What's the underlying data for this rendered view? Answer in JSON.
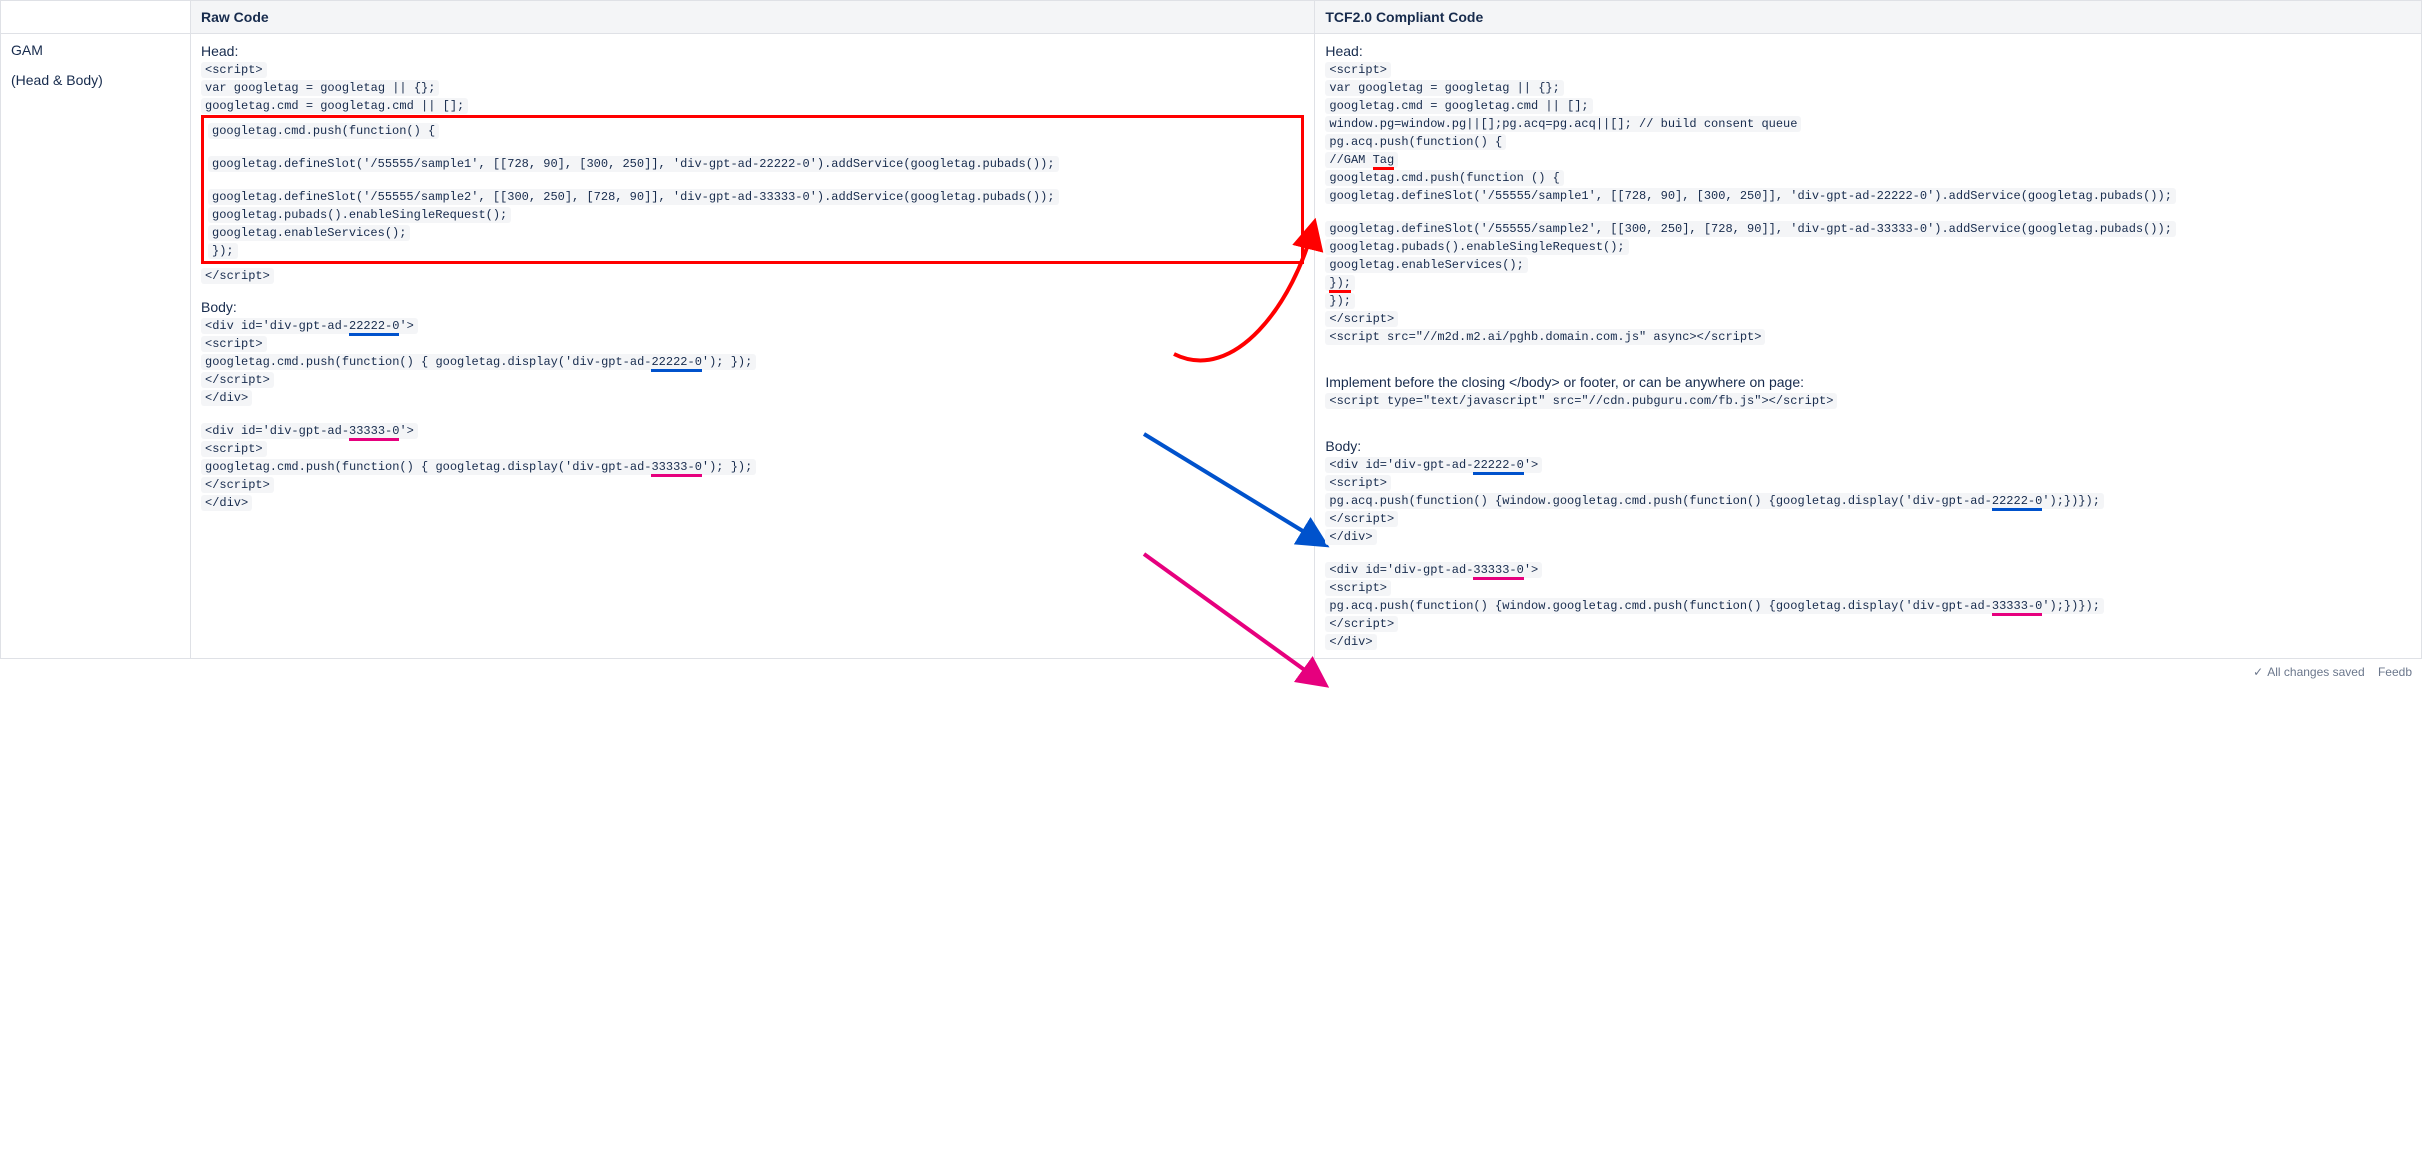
{
  "headers": {
    "col1": "",
    "col2": "Raw Code",
    "col3": "TCF2.0 Compliant Code"
  },
  "row": {
    "label_line1": "GAM",
    "label_line2": "(Head & Body)"
  },
  "raw": {
    "head_label": "Head:",
    "l1": "<script>",
    "l2": "var googletag = googletag || {};",
    "l3": "googletag.cmd = googletag.cmd || [];",
    "box_l1": "googletag.cmd.push(function() {",
    "box_l2": "googletag.defineSlot('/55555/sample1', [[728, 90], [300, 250]], 'div-gpt-ad-22222-0').addService(googletag.pubads());",
    "box_l3": "googletag.defineSlot('/55555/sample2', [[300, 250], [728, 90]], 'div-gpt-ad-33333-0').addService(googletag.pubads());",
    "box_l4": "googletag.pubads().enableSingleRequest();",
    "box_l5": "googletag.enableServices();",
    "box_l6": "});",
    "l4": "</script>",
    "body_label": "Body:",
    "b1a": "<div id='div-gpt-ad-",
    "b1b": "22222-0",
    "b1c": "'>",
    "b2": "<script>",
    "b3a": "googletag.cmd.push(function() { googletag.display('div-gpt-ad-",
    "b3b": "22222-0",
    "b3c": "'); });",
    "b4": "</script>",
    "b5": "</div>",
    "c1a": "<div id='div-gpt-ad-",
    "c1b": "33333-0",
    "c1c": "'>",
    "c2": "<script>",
    "c3a": "googletag.cmd.push(function() { googletag.display('div-gpt-ad-",
    "c3b": "33333-0",
    "c3c": "'); });",
    "c4": "</script>",
    "c5": "</div>"
  },
  "tcf": {
    "head_label": "Head:",
    "l1": "<script>",
    "l2": "var googletag = googletag || {};",
    "l3": "googletag.cmd = googletag.cmd || [];",
    "l4": "window.pg=window.pg||[];pg.acq=pg.acq||[]; // build consent queue",
    "l5a": "pg.acq.push(function() {",
    "l6a": "//GAM ",
    "l6b": "Tag",
    "h1": "googletag.cmd.push(function () {",
    "h2": "googletag.defineSlot('/55555/sample1', [[728, 90], [300, 250]], 'div-gpt-ad-22222-0').addService(googletag.pubads());",
    "h3": "googletag.defineSlot('/55555/sample2', [[300, 250], [728, 90]], 'div-gpt-ad-33333-0').addService(googletag.pubads());",
    "h4": "googletag.pubads().enableSingleRequest();",
    "h5": "googletag.enableServices();",
    "h6a": "});",
    "l7": "});",
    "l8": "</script>",
    "l9": "<script src=\"//m2d.m2.ai/pghb.domain.com.js\" async></script>",
    "note": "Implement before the closing </body> or footer, or can be anywhere on page:",
    "l10": "<script type=\"text/javascript\" src=\"//cdn.pubguru.com/fb.js\"></script>",
    "body_label": "Body:",
    "b1a": "<div id='div-gpt-ad-",
    "b1b": "22222-0",
    "b1c": "'>",
    "b2": "<script>",
    "b3a": "pg.acq.push(function() {window.googletag.cmd.push(function() {googletag.display('div-gpt-ad-",
    "b3b": "22222-0",
    "b3c": "');})});",
    "b4": "</script>",
    "b5": "</div>",
    "c1a": "<div id='div-gpt-ad-",
    "c1b": "33333-0",
    "c1c": "'>",
    "c2": "<script>",
    "c3a": "pg.acq.push(function() {window.googletag.cmd.push(function() {googletag.display('div-gpt-ad-",
    "c3b": "33333-0",
    "c3c": "');})});",
    "c4": "</script>",
    "c5": "</div>"
  },
  "footer": {
    "saved": "All changes saved",
    "feedback": "Feedb"
  }
}
